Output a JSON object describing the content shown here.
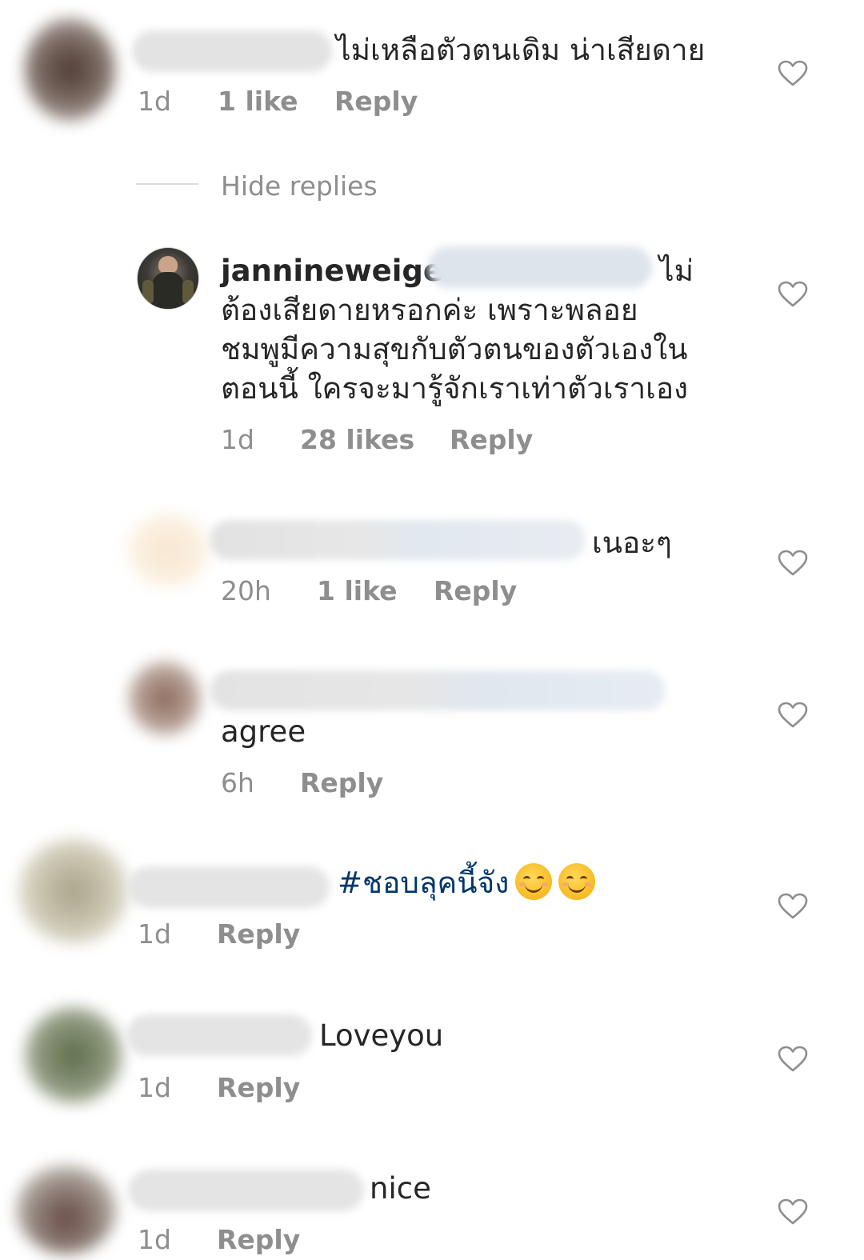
{
  "comments": [
    {
      "text": "ไม่เหลือตัวตนเดิม น่าเสียดาย",
      "time": "1d",
      "likes": "1 like",
      "reply": "Reply"
    },
    {
      "hide_replies": "Hide replies"
    },
    {
      "username": "jannineweigel",
      "line1": "ไม่",
      "line2": "ต้องเสียดายหรอกค่ะ เพราะพลอย",
      "line3": "ชมพูมีความสุขกับตัวตนของตัวเองใน",
      "line4": "ตอนนี้ ใครจะมารู้จักเราเท่าตัวเราเอง",
      "time": "1d",
      "likes": "28 likes",
      "reply": "Reply"
    },
    {
      "text": "เนอะๆ",
      "time": "20h",
      "likes": "1 like",
      "reply": "Reply"
    },
    {
      "text": "agree",
      "time": "6h",
      "reply": "Reply"
    },
    {
      "text": "#ชอบลุคนี้จัง",
      "emoji": "smiling-face-emoji",
      "time": "1d",
      "reply": "Reply"
    },
    {
      "text": "Loveyou",
      "time": "1d",
      "reply": "Reply"
    },
    {
      "text": "nice",
      "time": "1d",
      "reply": "Reply"
    }
  ],
  "colors": {
    "text": "#262626",
    "meta": "#8e8e8e",
    "hashtag": "#00376b",
    "heart": "#8e8e8e"
  },
  "icons": {
    "like": "heart-outline-icon"
  }
}
